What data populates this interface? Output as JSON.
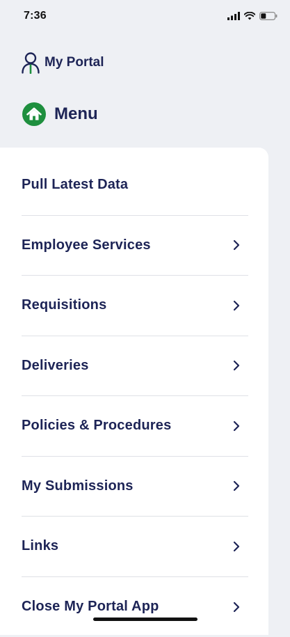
{
  "status_bar": {
    "time": "7:36"
  },
  "header": {
    "portal_title": "My Portal",
    "portal_icon": "person-icon",
    "menu_title": "Menu",
    "menu_icon": "home-icon"
  },
  "colors": {
    "accent_green": "#1e8f3e",
    "text_navy": "#1d2456",
    "background": "#eef0f4"
  },
  "menu": {
    "items": [
      {
        "label": "Pull Latest Data"
      },
      {
        "label": "Employee Services"
      },
      {
        "label": "Requisitions"
      },
      {
        "label": "Deliveries"
      },
      {
        "label": "Policies & Procedures"
      },
      {
        "label": "My Submissions"
      },
      {
        "label": "Links"
      },
      {
        "label": "Close My Portal App"
      }
    ]
  }
}
